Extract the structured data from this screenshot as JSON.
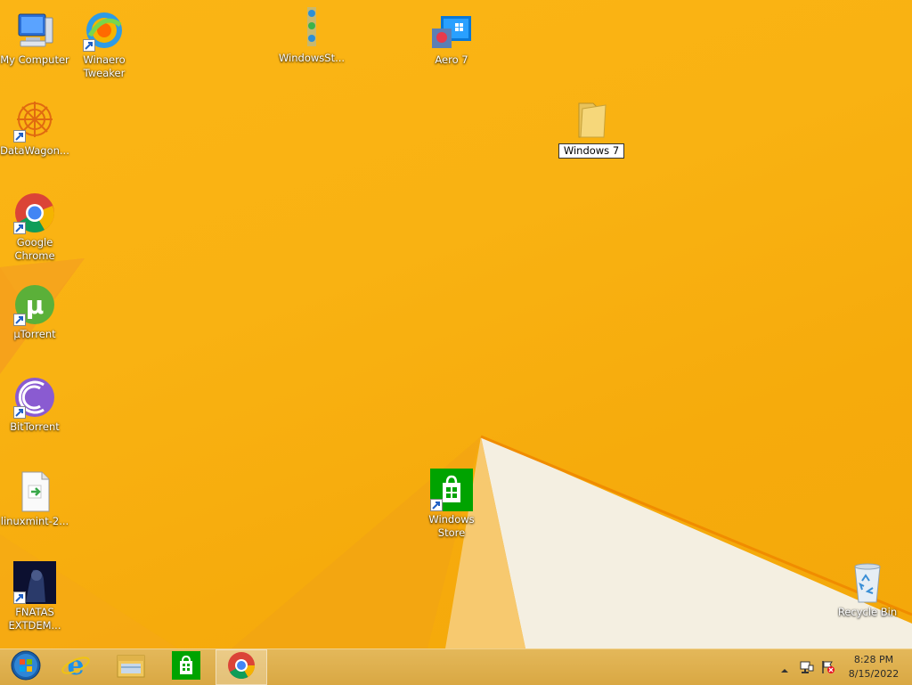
{
  "desktop": {
    "icons": [
      {
        "id": "my-computer",
        "label": "My Computer"
      },
      {
        "id": "winaero-tweaker",
        "label": "Winaero\nTweaker"
      },
      {
        "id": "windowsst",
        "label": "WindowsSt..."
      },
      {
        "id": "aero7",
        "label": "Aero 7"
      },
      {
        "id": "datawagon",
        "label": "DataWagon..."
      },
      {
        "id": "windows7-folder",
        "label": "Windows 7"
      },
      {
        "id": "chrome",
        "label": "Google\nChrome"
      },
      {
        "id": "utorrent",
        "label": "µTorrent"
      },
      {
        "id": "bittorrent",
        "label": "BitTorrent"
      },
      {
        "id": "linuxmint",
        "label": "linuxmint-2..."
      },
      {
        "id": "windows-store",
        "label": "Windows\nStore"
      },
      {
        "id": "fnatas",
        "label": "FNATAS\nEXTDEM..."
      },
      {
        "id": "recycle-bin",
        "label": "Recycle Bin"
      }
    ]
  },
  "taskbar": {
    "items": [
      {
        "name": "start",
        "icon": "windows-orb-icon"
      },
      {
        "name": "internet-explorer",
        "icon": "internet-explorer-icon"
      },
      {
        "name": "file-explorer",
        "icon": "file-explorer-icon"
      },
      {
        "name": "store",
        "icon": "store-icon"
      },
      {
        "name": "chrome",
        "icon": "chrome-icon",
        "active": true
      }
    ],
    "tray": {
      "time": "8:28 PM",
      "date": "8/15/2022"
    }
  },
  "colors": {
    "wallpaper": "#f9b212",
    "taskbar": "#dcae4c",
    "store_green": "#00a300"
  }
}
